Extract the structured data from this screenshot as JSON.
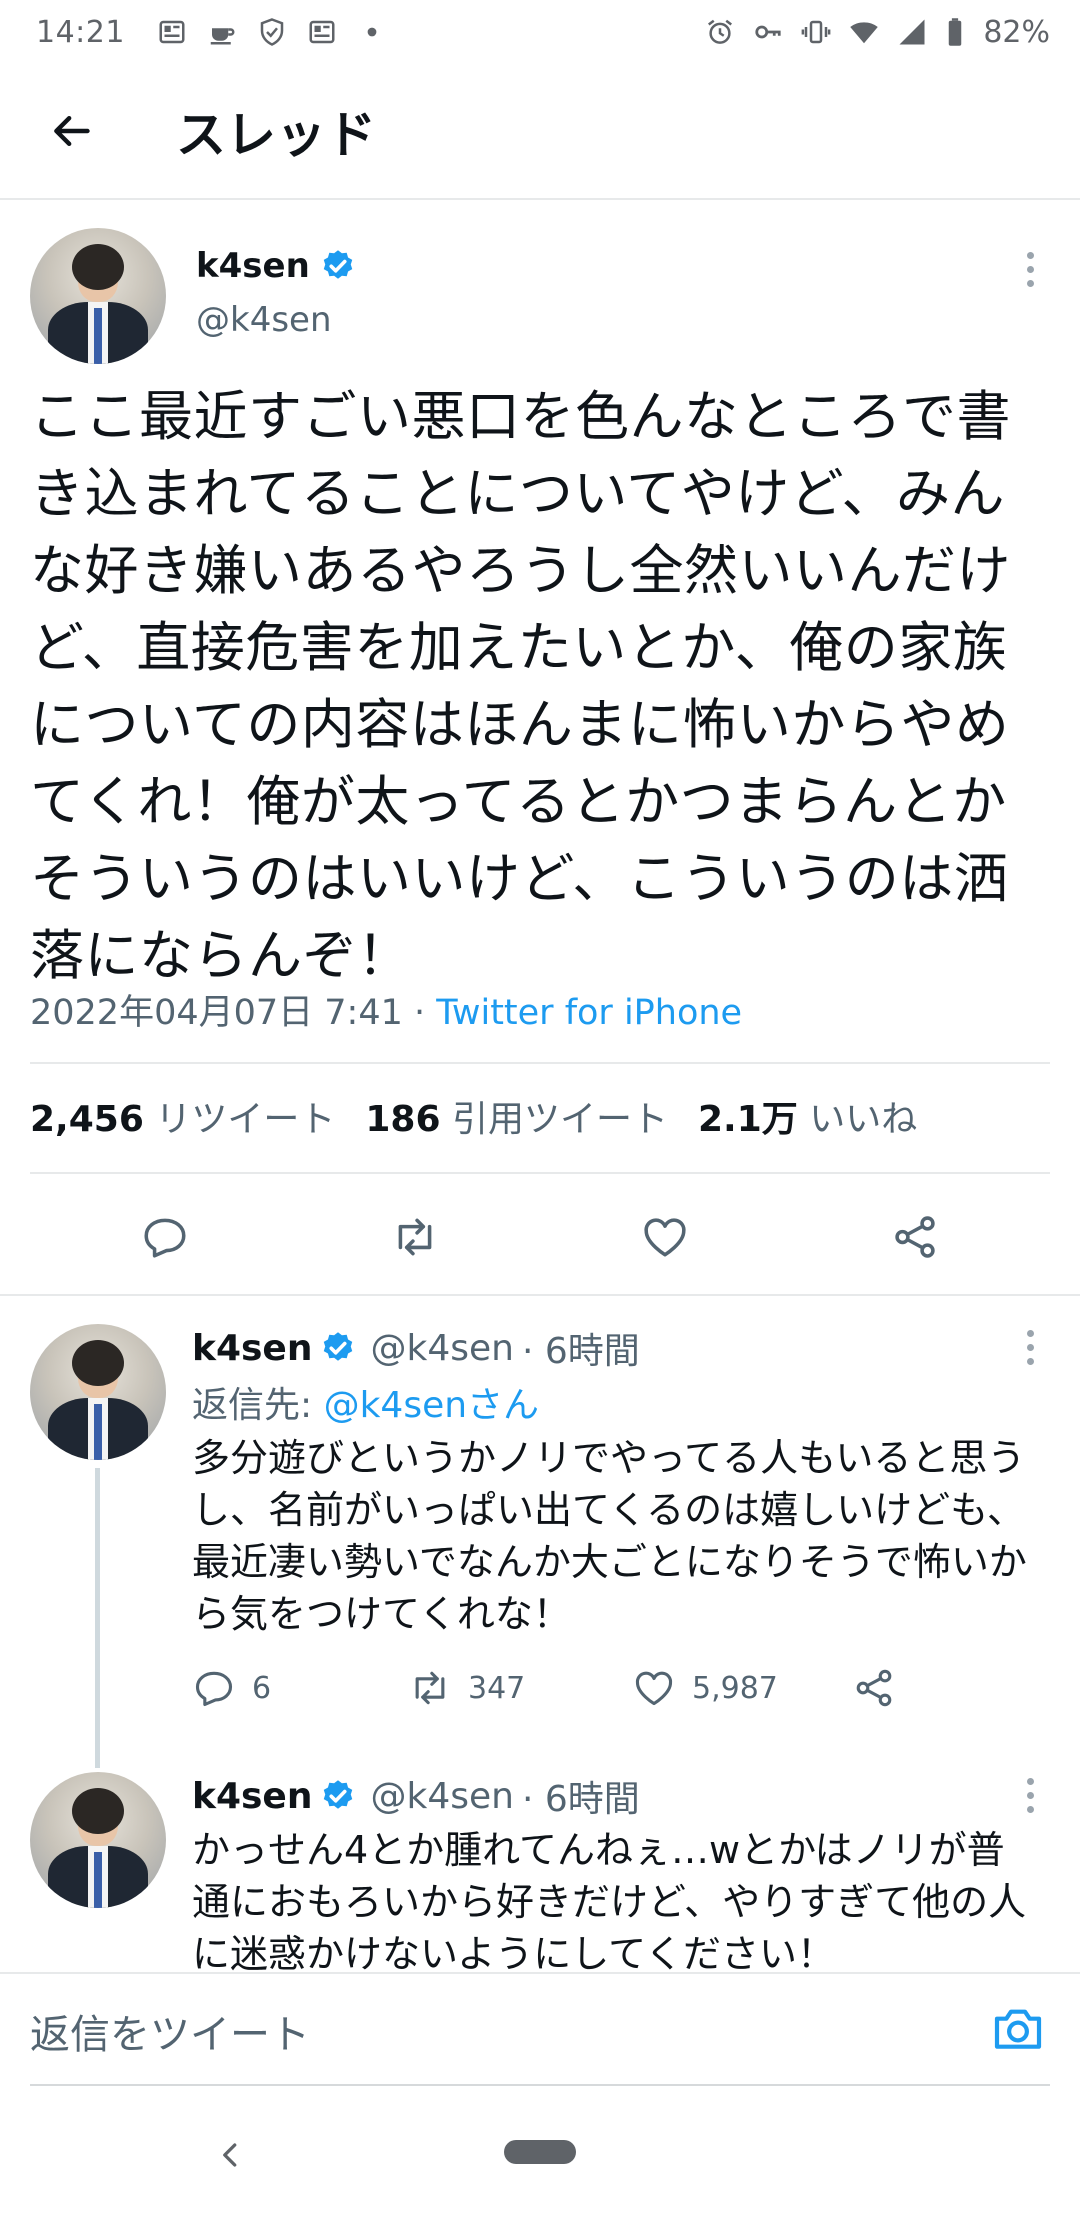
{
  "status_bar": {
    "time": "14:21",
    "battery": "82%",
    "icons_left": [
      "news-icon",
      "coffee-icon",
      "shield-check-icon",
      "news-icon",
      "dot-icon"
    ],
    "icons_right": [
      "alarm-icon",
      "key-icon",
      "vibrate-icon",
      "wifi-icon",
      "signal-icon",
      "battery-icon"
    ]
  },
  "header": {
    "title": "スレッド"
  },
  "main_tweet": {
    "name": "k4sen",
    "handle": "@k4sen",
    "text": "ここ最近すごい悪口を色んなところで書き込まれてることについてやけど、みんな好き嫌いあるやろうし全然いいんだけど、直接危害を加えたいとか、俺の家族についての内容はほんまに怖いからやめてくれ！俺が太ってるとかつまらんとかそういうのはいいけど、こういうのは洒落にならんぞ！",
    "timestamp": "2022年04月07日 7:41",
    "separator": " · ",
    "source": "Twitter for iPhone",
    "stats": {
      "retweets_count": "2,456",
      "retweets_label": "リツイート",
      "quotes_count": "186",
      "quotes_label": "引用ツイート",
      "likes_count": "2.1万",
      "likes_label": "いいね"
    }
  },
  "replies": [
    {
      "name": "k4sen",
      "handle": "@k4sen",
      "time": "· 6時間",
      "reply_to_label": "返信先: ",
      "reply_to_mention": "@k4senさん",
      "text": "多分遊びというかノリでやってる人もいると思うし、名前がいっぱい出てくるのは嬉しいけども、最近凄い勢いでなんか大ごとになりそうで怖いから気をつけてくれな！",
      "replies_count": "6",
      "retweets_count": "347",
      "likes_count": "5,987"
    },
    {
      "name": "k4sen",
      "handle": "@k4sen",
      "time": "· 6時間",
      "text": "かっせん4とか腫れてんねぇ…wとかはノリが普通におもろいから好きだけど、やりすぎて他の人に迷惑かけないようにしてください！"
    }
  ],
  "reply_bar": {
    "placeholder": "返信をツイート"
  },
  "colors": {
    "accent": "#1d9bf0",
    "text_primary": "#0f1419",
    "text_secondary": "#536471",
    "divider": "#e7e9ea"
  }
}
